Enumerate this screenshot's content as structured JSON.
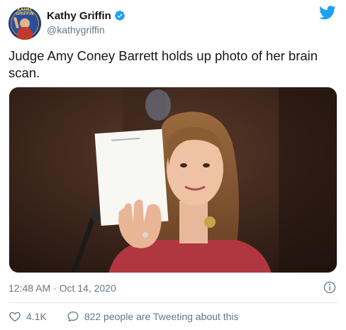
{
  "author": {
    "display_name": "Kathy Griffin",
    "handle": "@kathygriffin",
    "avatar_seal_text": "KATHY GRIFFIN"
  },
  "tweet": {
    "text": "Judge Amy Coney Barrett holds up photo of her brain scan.",
    "timestamp": "12:48 AM · Oct 14, 2020"
  },
  "stats": {
    "likes": "4.1K",
    "conversation": "822 people are Tweeting about this"
  },
  "icons": {
    "verified": "verified-badge-icon",
    "brand": "twitter-bird-icon",
    "info": "info-icon",
    "like": "heart-icon",
    "reply": "speech-bubble-icon"
  },
  "colors": {
    "brand_blue": "#1da1f2",
    "text_secondary": "#657786",
    "divider": "#e1e8ed"
  }
}
